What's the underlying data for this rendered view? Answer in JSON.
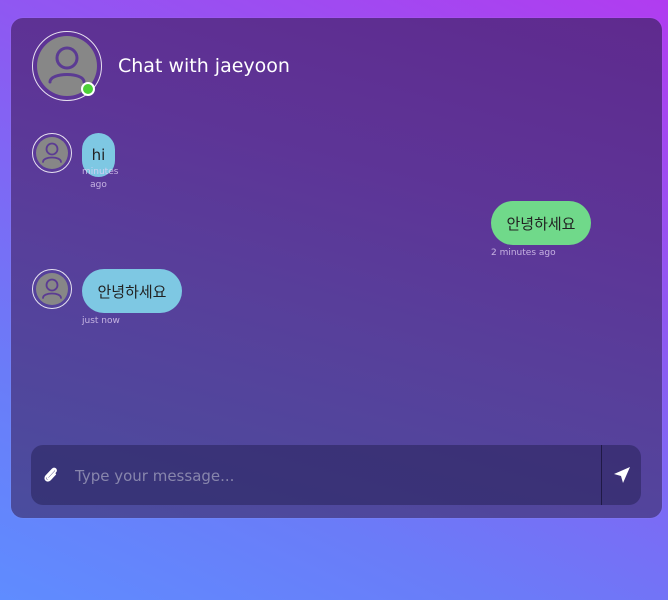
{
  "header": {
    "title": "Chat with jaeyoon",
    "avatar_icon": "user-icon",
    "status": "online",
    "status_color": "#4cd137"
  },
  "messages": [
    {
      "direction": "incoming",
      "text": "hi",
      "time": "minutes ago"
    },
    {
      "direction": "outgoing",
      "text": "안녕하세요",
      "time": "2 minutes ago"
    },
    {
      "direction": "incoming",
      "text": "안녕하세요",
      "time": "just now"
    }
  ],
  "composer": {
    "placeholder": "Type your message...",
    "attach_icon": "paperclip-icon",
    "send_icon": "send-icon"
  },
  "colors": {
    "incoming_bubble": "#7ec8e3",
    "outgoing_bubble": "#70d98a"
  }
}
